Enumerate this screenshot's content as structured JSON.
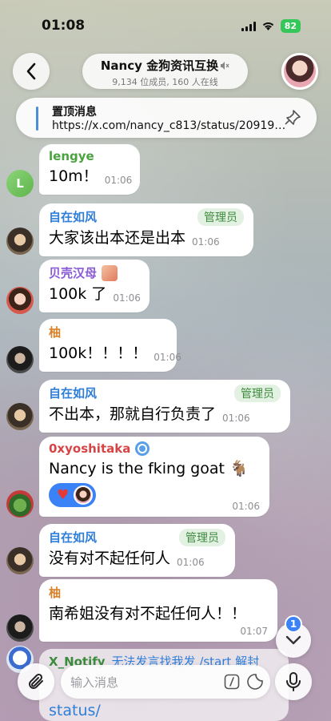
{
  "status": {
    "time": "01:08",
    "battery": "82"
  },
  "header": {
    "title": "Nancy 金狗资讯互换",
    "subtitle": "9,134 位成员, 160 人在线"
  },
  "pinned": {
    "title": "置顶消息",
    "text": "https://x.com/nancy_c813/status/209193..."
  },
  "messages": [
    {
      "sender": "lengye",
      "text": "10m！",
      "time": "01:06",
      "name_color": "#4aa33f",
      "avatar_letter": "L"
    },
    {
      "sender": "自在如风",
      "role": "管理员",
      "text": "大家该出本还是出本",
      "time": "01:06",
      "name_color": "#2f7ed8"
    },
    {
      "sender": "贝壳汉母",
      "text": "100k 了",
      "time": "01:06",
      "name_color": "#8a5bd6"
    },
    {
      "sender": "柚",
      "text": "100k！！！！",
      "time": "01:06",
      "name_color": "#d9822b"
    },
    {
      "sender": "自在如风",
      "role": "管理员",
      "text": "不出本，那就自行负责了",
      "time": "01:06",
      "name_color": "#2f7ed8"
    },
    {
      "sender": "0xyoshitaka",
      "text": "Nancy is the fking goat 🐐",
      "time": "01:06",
      "name_color": "#d64545",
      "reaction": "♥"
    },
    {
      "sender": "自在如风",
      "role": "管理员",
      "text": "没有对不起任何人",
      "time": "01:06",
      "name_color": "#2f7ed8"
    },
    {
      "sender": "柚",
      "text": "南希姐没有对不起任何人！！",
      "time": "01:07",
      "name_color": "#d9822b"
    }
  ],
  "partial": {
    "sender": "X_Notify",
    "preview": "无法发言找我发 /start 解封",
    "text": "status/"
  },
  "unread_count": "1",
  "input": {
    "placeholder": "输入消息"
  }
}
